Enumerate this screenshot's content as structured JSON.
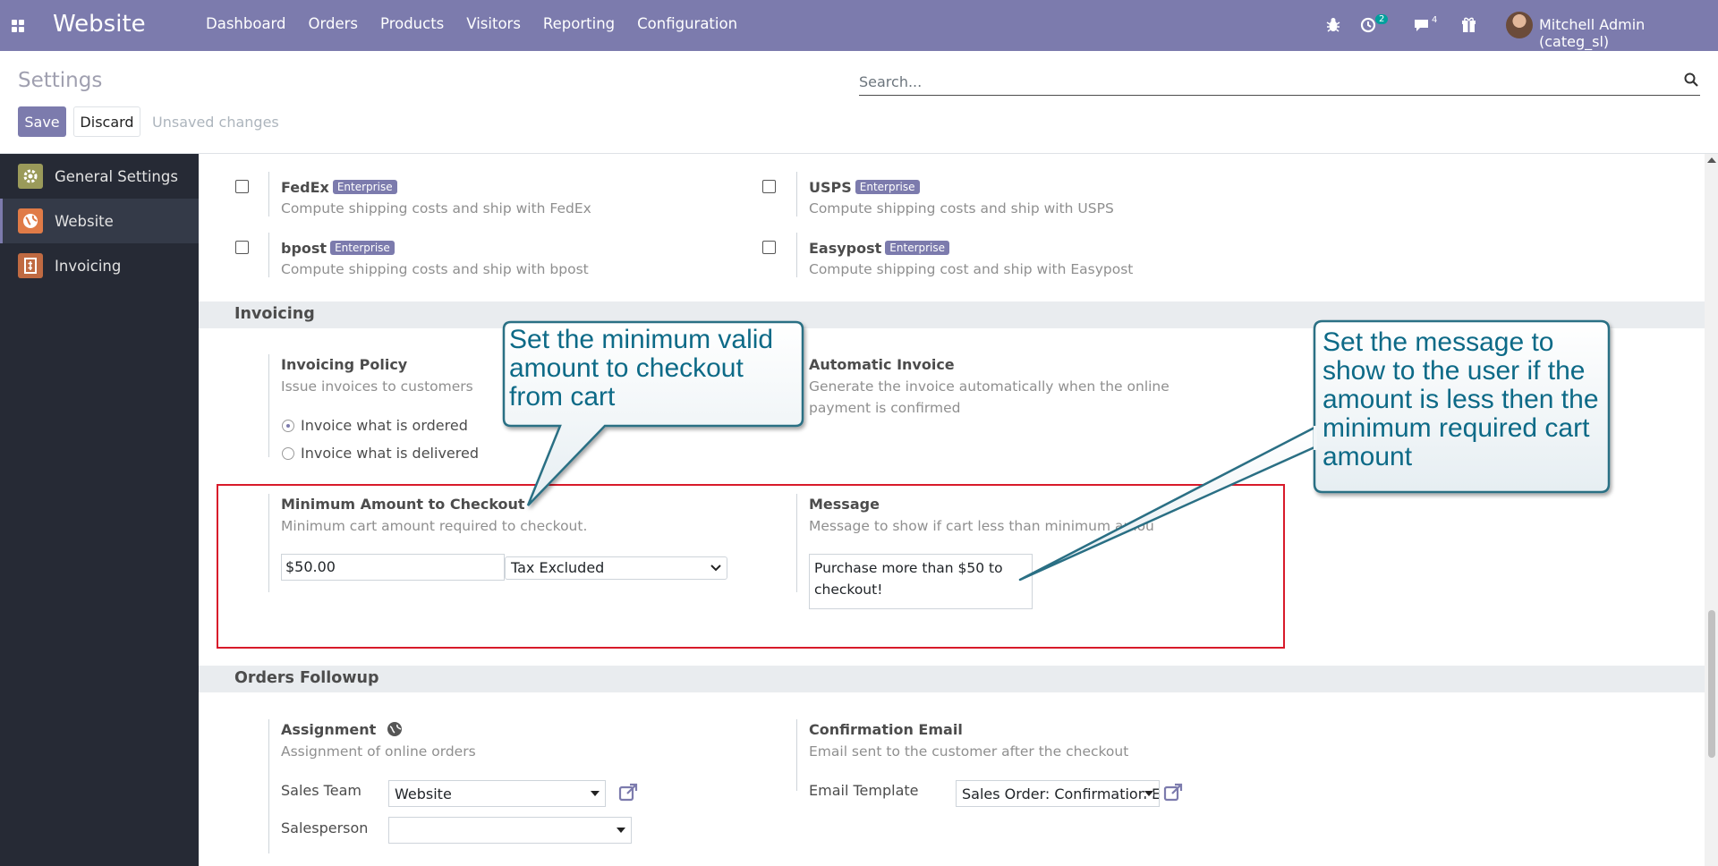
{
  "navbar": {
    "brand": "Website",
    "menu": [
      "Dashboard",
      "Orders",
      "Products",
      "Visitors",
      "Reporting",
      "Configuration"
    ],
    "activity_count": "2",
    "message_count": "4",
    "user": "Mitchell Admin (categ_sl)"
  },
  "control_panel": {
    "title": "Settings",
    "search_placeholder": "Search...",
    "save_label": "Save",
    "discard_label": "Discard",
    "status": "Unsaved changes"
  },
  "sidebar": {
    "items": [
      {
        "label": "General Settings",
        "active": false
      },
      {
        "label": "Website",
        "active": true
      },
      {
        "label": "Invoicing",
        "active": false
      }
    ]
  },
  "shipping": {
    "fedex": {
      "label": "FedEx",
      "badge": "Enterprise",
      "desc": "Compute shipping costs and ship with FedEx"
    },
    "usps": {
      "label": "USPS",
      "badge": "Enterprise",
      "desc": "Compute shipping costs and ship with USPS"
    },
    "bpost": {
      "label": "bpost",
      "badge": "Enterprise",
      "desc": "Compute shipping costs and ship with bpost"
    },
    "easypost": {
      "label": "Easypost",
      "badge": "Enterprise",
      "desc": "Compute shipping cost and ship with Easypost"
    }
  },
  "invoicing": {
    "section_title": "Invoicing",
    "policy_label": "Invoicing Policy",
    "policy_desc": "Issue invoices to customers",
    "option_ordered": "Invoice what is ordered",
    "option_delivered": "Invoice what is delivered",
    "auto_label": "Automatic Invoice",
    "auto_desc": "Generate the invoice automatically when the online payment is confirmed",
    "min_label": "Minimum Amount to Checkout",
    "min_desc": "Minimum cart amount required to checkout.",
    "min_value": "$50.00",
    "tax_value": "Tax Excluded",
    "msg_label": "Message",
    "msg_desc": "Message to show if cart less than minimum amou",
    "msg_value": "Purchase more than $50 to checkout!"
  },
  "followup": {
    "section_title": "Orders Followup",
    "assign_label": "Assignment",
    "assign_desc": "Assignment of online orders",
    "team_label": "Sales Team",
    "team_value": "Website",
    "salesperson_label": "Salesperson",
    "salesperson_value": "",
    "confirm_label": "Confirmation Email",
    "confirm_desc": "Email sent to the customer after the checkout",
    "template_label": "Email Template",
    "template_value": "Sales Order: Confirmation E"
  },
  "callouts": {
    "left": "Set the minimum valid amount to checkout from cart",
    "right": "Set the message to show to the user if the amount is less then the minimum required cart amount"
  }
}
